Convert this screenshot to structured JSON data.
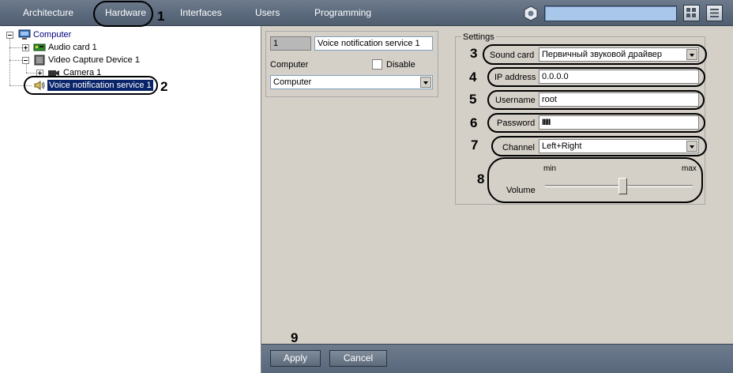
{
  "toolbar": {
    "tabs": [
      {
        "label": "Architecture"
      },
      {
        "label": "Hardware"
      },
      {
        "label": "Interfaces"
      },
      {
        "label": "Users"
      },
      {
        "label": "Programming"
      }
    ],
    "search_value": ""
  },
  "tree": {
    "root": "Computer",
    "audio_card": "Audio card 1",
    "video_device": "Video Capture Device 1",
    "camera": "Camera 1",
    "voice_service": "Voice notification service 1"
  },
  "object": {
    "id": "1",
    "name": "Voice notification service 1",
    "computer_label": "Computer",
    "disable_label": "Disable",
    "computer_value": "Computer"
  },
  "settings": {
    "legend": "Settings",
    "sound_card_label": "Sound card",
    "sound_card_value": "Первичный звуковой драйвер",
    "ip_label": "IP address",
    "ip_value": "0.0.0.0",
    "username_label": "Username",
    "username_value": "root",
    "password_label": "Password",
    "password_value": "IIIII",
    "channel_label": "Channel",
    "channel_value": "Left+Right",
    "volume_label": "Volume",
    "volume_min": "min",
    "volume_max": "max",
    "volume_level_percent": 53
  },
  "annotations": [
    "1",
    "2",
    "3",
    "4",
    "5",
    "6",
    "7",
    "8",
    "9"
  ],
  "buttons": {
    "apply": "Apply",
    "cancel": "Cancel"
  },
  "colors": {
    "toolbar": "#59687a",
    "search": "#a9c7ea",
    "panel": "#d4d0c8",
    "tree_link": "#00007f"
  }
}
